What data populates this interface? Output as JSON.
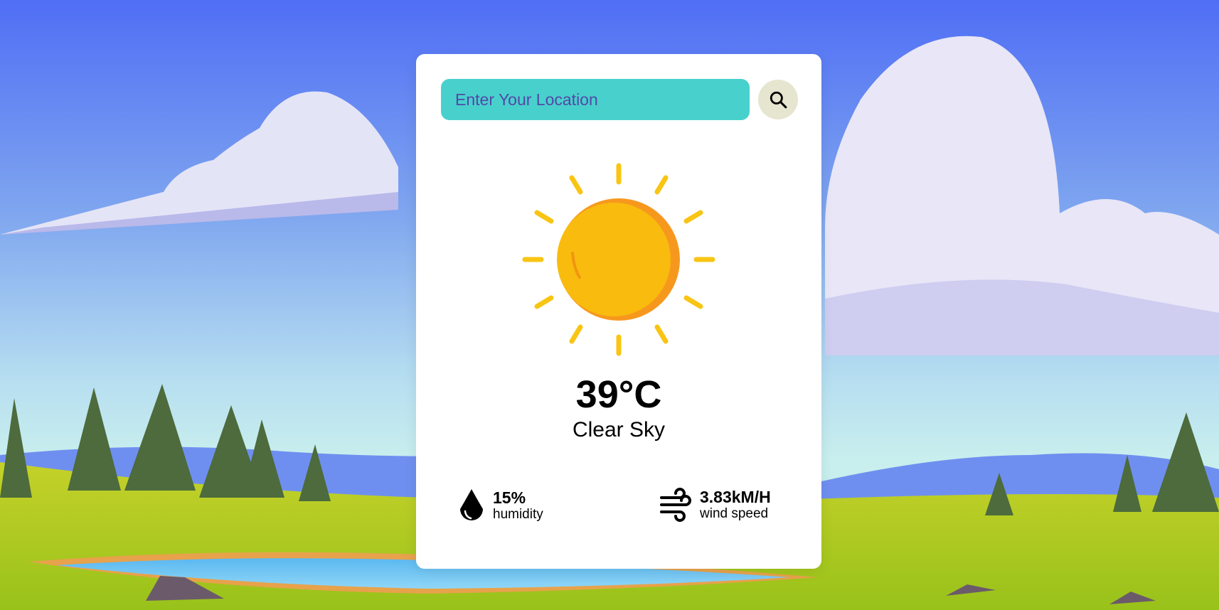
{
  "search": {
    "placeholder": "Enter Your Location",
    "value": "",
    "icon": "search-icon"
  },
  "weather": {
    "icon": "sun-icon",
    "temperature": "39°C",
    "description": "Clear Sky"
  },
  "details": {
    "humidity": {
      "icon": "water-drop-icon",
      "value": "15%",
      "label": "humidity"
    },
    "wind": {
      "icon": "wind-icon",
      "value": "3.83kM/H",
      "label": "wind speed"
    }
  },
  "colors": {
    "search_bg": "#48d1cc",
    "search_button_bg": "#e6e5cf",
    "sun": "#f9bb0d",
    "sun_shadow": "#f7981e",
    "card_bg": "#ffffff"
  }
}
